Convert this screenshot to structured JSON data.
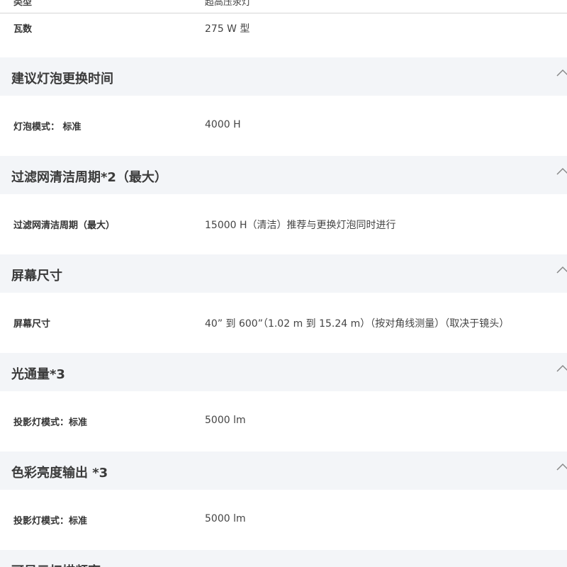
{
  "top_rows": [
    {
      "label": "类型",
      "value": "超高压汞灯"
    },
    {
      "label": "瓦数",
      "value": "275 W 型"
    }
  ],
  "sections": [
    {
      "title": "建议灯泡更换时间",
      "rows": [
        {
          "label": "灯泡模式： 标准",
          "value": "4000 H"
        }
      ]
    },
    {
      "title": "过滤网清洁周期*2（最大）",
      "rows": [
        {
          "label": "过滤网清洁周期（最大）",
          "value": "15000 H（清洁）推荐与更换灯泡同时进行"
        }
      ]
    },
    {
      "title": "屏幕尺寸",
      "rows": [
        {
          "label": "屏幕尺寸",
          "value": "40” 到 600”（1.02 m 到 15.24 m）（按对角线测量）（取决于镜头）"
        }
      ]
    },
    {
      "title": "光通量*3",
      "rows": [
        {
          "label": "投影灯模式：标准",
          "value": "5000 lm"
        }
      ]
    },
    {
      "title": "色彩亮度输出 *3",
      "rows": [
        {
          "label": "投影灯模式：标准",
          "value": "5000 lm"
        }
      ]
    },
    {
      "title": "可显示扫描频率",
      "rows": []
    }
  ],
  "icons": {
    "collapse": "chevron-up-icon"
  },
  "colors": {
    "section_bg": "#f3f5f8",
    "divider": "#d6d6d6"
  }
}
